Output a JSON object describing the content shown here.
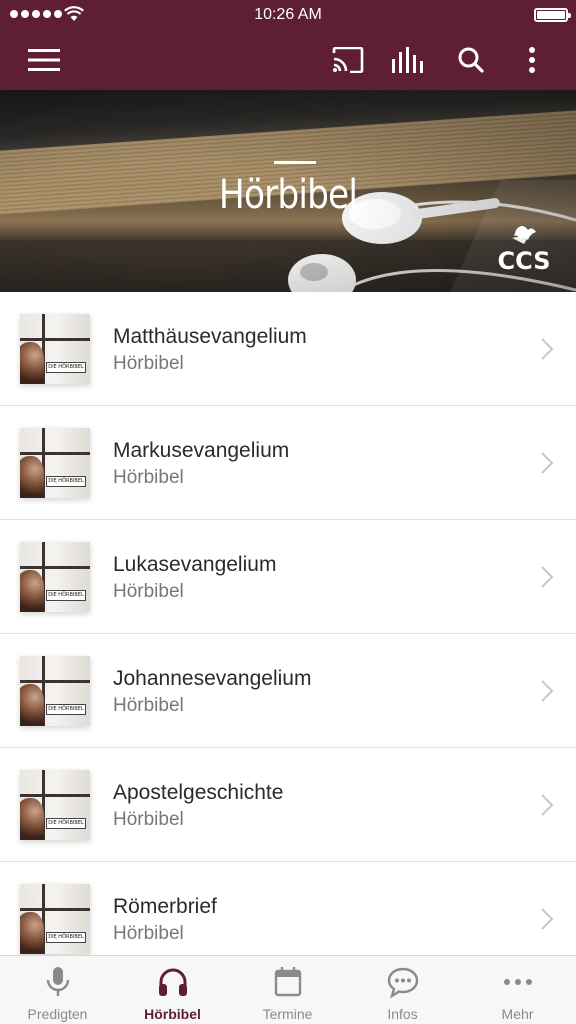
{
  "status_bar": {
    "time": "10:26 AM"
  },
  "app_bar": {
    "icons": [
      "menu-icon",
      "cast-icon",
      "equalizer-icon",
      "search-icon",
      "more-vertical-icon"
    ],
    "color": "#5e1f33"
  },
  "hero": {
    "title": "Hörbibel",
    "logo_text": "CCS"
  },
  "list": {
    "thumbnail_label": "DIE HÖRBIBEL",
    "items": [
      {
        "title": "Matthäusevangelium",
        "subtitle": "Hörbibel"
      },
      {
        "title": "Markusevangelium",
        "subtitle": "Hörbibel"
      },
      {
        "title": "Lukasevangelium",
        "subtitle": "Hörbibel"
      },
      {
        "title": "Johannesevangelium",
        "subtitle": "Hörbibel"
      },
      {
        "title": "Apostelgeschichte",
        "subtitle": "Hörbibel"
      },
      {
        "title": "Römerbrief",
        "subtitle": "Hörbibel"
      }
    ]
  },
  "tab_bar": {
    "active_color": "#5e1f33",
    "tabs": [
      {
        "label": "Predigten",
        "icon": "microphone-icon"
      },
      {
        "label": "Hörbibel",
        "icon": "headphones-icon",
        "active": true
      },
      {
        "label": "Termine",
        "icon": "calendar-icon"
      },
      {
        "label": "Infos",
        "icon": "chat-bubble-icon"
      },
      {
        "label": "Mehr",
        "icon": "more-horizontal-icon"
      }
    ]
  }
}
